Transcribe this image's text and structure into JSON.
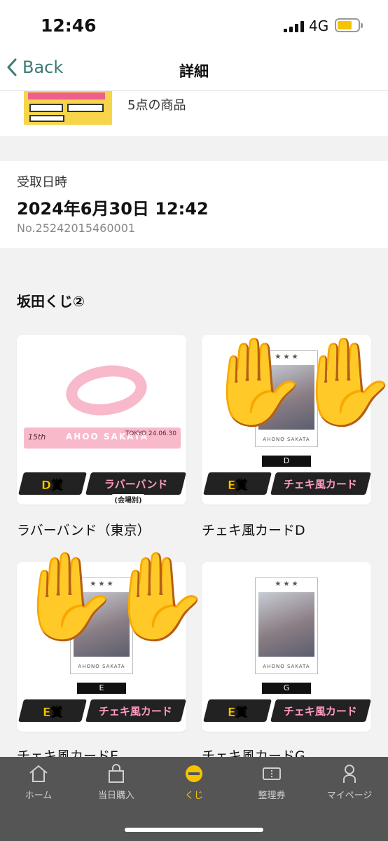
{
  "status_bar": {
    "time": "12:46",
    "network": "4G"
  },
  "nav": {
    "back_label": "Back",
    "title": "詳細"
  },
  "items_summary": {
    "count_text": "5点の商品"
  },
  "receipt": {
    "label": "受取日時",
    "datetime": "2024年6月30日 12:42",
    "number": "No.25242015460001"
  },
  "kuji": {
    "title": "坂田くじ②",
    "items": [
      {
        "name": "ラバーバンド（東京）",
        "prize": "D賞",
        "prize_name": "ラバーバンド",
        "prize_sub": "(会場別)",
        "band_left": "15th",
        "band_mid": "AHOO SAKATA",
        "band_right": "TOKYO 24.06.30"
      },
      {
        "name": "チェキ風カードD",
        "prize": "E賞",
        "prize_name": "チェキ風カード",
        "letter": "D",
        "caption": "AHONO SAKATA"
      },
      {
        "name": "チェキ風カードE",
        "prize": "E賞",
        "prize_name": "チェキ風カード",
        "letter": "E",
        "caption": "AHONO SAKATA"
      },
      {
        "name": "チェキ風カードG",
        "prize": "E賞",
        "prize_name": "チェキ風カード",
        "letter": "G",
        "caption": "AHONO SAKATA"
      }
    ]
  },
  "tabs": [
    {
      "label": "ホーム",
      "icon": "home-icon"
    },
    {
      "label": "当日購入",
      "icon": "shopping-bag-icon"
    },
    {
      "label": "くじ",
      "icon": "kuji-icon",
      "active": true
    },
    {
      "label": "整理券",
      "icon": "ticket-icon"
    },
    {
      "label": "マイページ",
      "icon": "person-icon"
    }
  ],
  "colors": {
    "accent": "#f5c400",
    "back_link": "#3d7a75",
    "tabbar_bg": "#555555"
  }
}
